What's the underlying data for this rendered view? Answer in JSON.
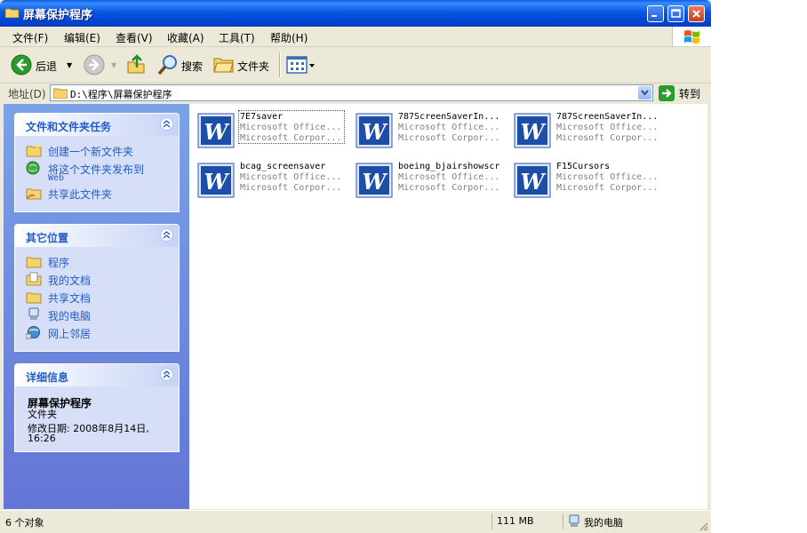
{
  "window": {
    "title": "屏幕保护程序"
  },
  "menu": [
    "文件(F)",
    "编辑(E)",
    "查看(V)",
    "收藏(A)",
    "工具(T)",
    "帮助(H)"
  ],
  "toolbar": {
    "back": "后退",
    "search": "搜索",
    "folders": "文件夹"
  },
  "address": {
    "label": "地址(D)",
    "path": "D:\\程序\\屏幕保护程序",
    "go": "转到"
  },
  "tasks": {
    "title": "文件和文件夹任务",
    "items": [
      {
        "label": "创建一个新文件夹",
        "icon": "new-folder-icon"
      },
      {
        "label": "将这个文件夹发布到",
        "sub": "Web",
        "icon": "publish-web-icon"
      },
      {
        "label": "共享此文件夹",
        "icon": "share-folder-icon"
      }
    ]
  },
  "places": {
    "title": "其它位置",
    "items": [
      {
        "label": "程序",
        "icon": "folder-icon"
      },
      {
        "label": "我的文档",
        "icon": "my-documents-icon"
      },
      {
        "label": "共享文档",
        "icon": "folder-icon"
      },
      {
        "label": "我的电脑",
        "icon": "my-computer-icon"
      },
      {
        "label": "网上邻居",
        "icon": "network-icon"
      }
    ]
  },
  "details": {
    "title": "详细信息",
    "name": "屏幕保护程序",
    "type": "文件夹",
    "modified_line1": "修改日期: 2008年8月14日,",
    "modified_line2": "16:26"
  },
  "files": [
    {
      "name": "7E7saver",
      "line2": "Microsoft Office...",
      "line3": "Microsoft Corpor...",
      "icon": "word-document-icon"
    },
    {
      "name": "787ScreenSaverIn...",
      "line2": "Microsoft Office...",
      "line3": "Microsoft Corpor...",
      "icon": "word-document-icon"
    },
    {
      "name": "787ScreenSaverIn...",
      "line2": "Microsoft Office...",
      "line3": "Microsoft Corpor...",
      "icon": "word-document-icon"
    },
    {
      "name": "bcag_screensaver",
      "line2": "Microsoft Office...",
      "line3": "Microsoft Corpor...",
      "icon": "word-document-icon"
    },
    {
      "name": "boeing_bjairshowscr",
      "line2": "Microsoft Office...",
      "line3": "Microsoft Corpor...",
      "icon": "word-document-icon"
    },
    {
      "name": "F15Cursors",
      "line2": "Microsoft Office...",
      "line3": "Microsoft Corpor...",
      "icon": "word-document-icon"
    }
  ],
  "status": {
    "objects": "6 个对象",
    "size": "111 MB",
    "location": "我的电脑"
  },
  "colors": {
    "titlebar": "#0a56e3",
    "taskpane": "#7ba2e7",
    "link": "#215dc6"
  }
}
